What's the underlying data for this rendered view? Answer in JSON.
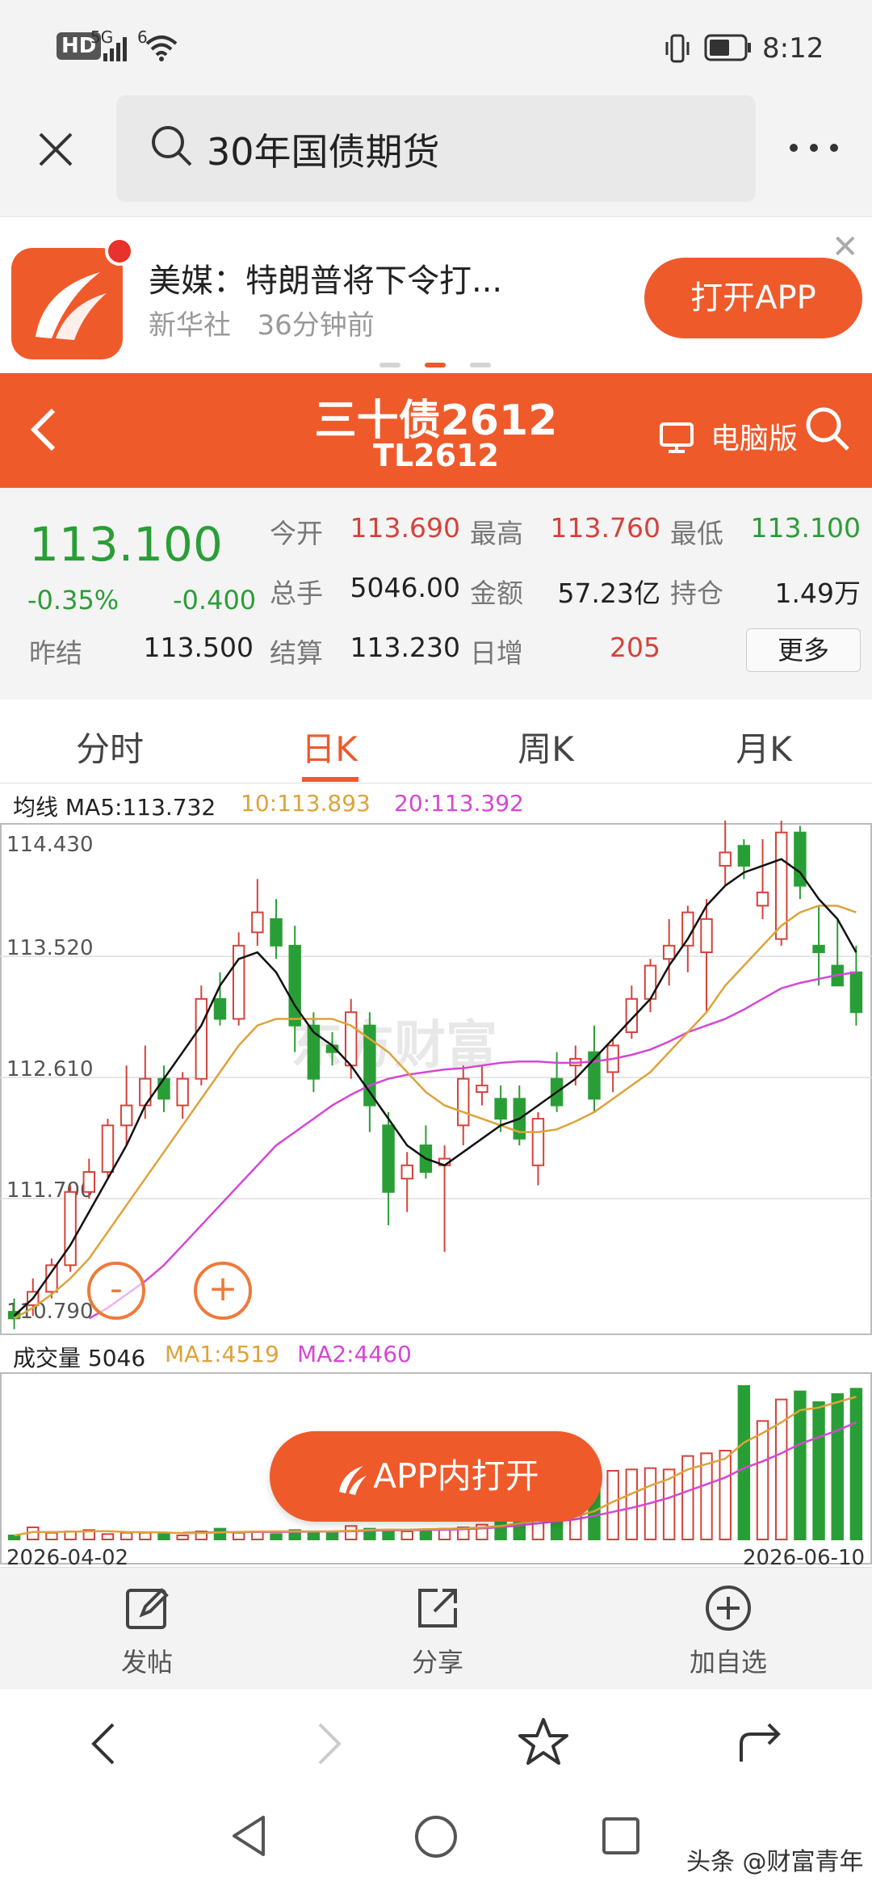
{
  "status_bar": {
    "hd": "HD",
    "signal_1": "5G",
    "signal_2": "6",
    "time": "8:12"
  },
  "search": {
    "query": "30年国债期货"
  },
  "ad": {
    "title": "美媒：特朗普将下令打...",
    "source": "新华社",
    "time_ago": "36分钟前",
    "open_app_label": "打开APP",
    "close_label": "✕"
  },
  "header": {
    "title": "三十债2612",
    "code": "TL2612",
    "pc_version_label": "电脑版"
  },
  "quote": {
    "last_price": "113.100",
    "change_pct": "-0.35%",
    "change_val": "-0.400",
    "rows": [
      [
        {
          "label": "今开",
          "value": "113.690",
          "color": "red"
        },
        {
          "label": "最高",
          "value": "113.760",
          "color": "red"
        },
        {
          "label": "最低",
          "value": "113.100",
          "color": "green"
        }
      ],
      [
        {
          "label": "总手",
          "value": "5046.00",
          "color": "dark"
        },
        {
          "label": "金额",
          "value": "57.23亿",
          "color": "dark"
        },
        {
          "label": "持仓",
          "value": "1.49万",
          "color": "dark"
        }
      ],
      [
        {
          "label": "结算",
          "value": "113.230",
          "color": "dark"
        },
        {
          "label": "日增",
          "value": "205",
          "color": "red"
        }
      ]
    ],
    "prev_settle_label": "昨结",
    "prev_settle_value": "113.500",
    "more_label": "更多"
  },
  "tabs": [
    {
      "label": "分时",
      "active": false
    },
    {
      "label": "日K",
      "active": true
    },
    {
      "label": "周K",
      "active": false
    },
    {
      "label": "月K",
      "active": false
    }
  ],
  "ma_legend": {
    "ma5": "均线 MA5:113.732",
    "ma10": "10:113.893",
    "ma20": "20:113.392"
  },
  "vol_legend": {
    "vol": "成交量 5046",
    "ma1": "MA1:4519",
    "ma2": "MA2:4460"
  },
  "colors": {
    "accent": "#ef5a2b",
    "up": "#d5423b",
    "down": "#2a9e36",
    "ma5": "#111111",
    "ma10": "#dda33a",
    "ma20": "#d646d6"
  },
  "chart_data": {
    "type": "candlestick",
    "y_ticks": [
      "114.430",
      "113.520",
      "112.610",
      "111.700",
      "110.790"
    ],
    "ylim": [
      110.79,
      114.43
    ],
    "x_start_label": "2026-04-02",
    "x_end_label": "2026-06-10",
    "watermark": "东方财富",
    "candles": [
      [
        110.85,
        110.95,
        110.72,
        110.8
      ],
      [
        110.9,
        111.1,
        110.82,
        111.0
      ],
      [
        111.0,
        111.25,
        110.95,
        111.2
      ],
      [
        111.2,
        111.8,
        111.15,
        111.75
      ],
      [
        111.75,
        112.0,
        111.7,
        111.9
      ],
      [
        111.9,
        112.3,
        111.85,
        112.25
      ],
      [
        112.25,
        112.7,
        112.1,
        112.4
      ],
      [
        112.4,
        112.85,
        112.3,
        112.6
      ],
      [
        112.6,
        112.7,
        112.35,
        112.45
      ],
      [
        112.4,
        112.65,
        112.3,
        112.6
      ],
      [
        112.6,
        113.3,
        112.55,
        113.2
      ],
      [
        113.2,
        113.4,
        113.0,
        113.05
      ],
      [
        113.05,
        113.7,
        113.0,
        113.6
      ],
      [
        113.7,
        114.1,
        113.6,
        113.85
      ],
      [
        113.8,
        113.95,
        113.5,
        113.6
      ],
      [
        113.6,
        113.75,
        112.8,
        113.0
      ],
      [
        113.0,
        113.1,
        112.5,
        112.6
      ],
      [
        112.85,
        112.95,
        112.7,
        112.8
      ],
      [
        112.7,
        113.2,
        112.6,
        113.1
      ],
      [
        113.0,
        113.1,
        112.2,
        112.4
      ],
      [
        112.25,
        112.35,
        111.5,
        111.75
      ],
      [
        111.85,
        112.05,
        111.6,
        111.95
      ],
      [
        112.1,
        112.25,
        111.85,
        111.9
      ],
      [
        111.95,
        112.1,
        111.3,
        112.0
      ],
      [
        112.25,
        112.7,
        112.1,
        112.6
      ],
      [
        112.5,
        112.7,
        112.4,
        112.55
      ],
      [
        112.45,
        112.55,
        112.2,
        112.3
      ],
      [
        112.45,
        112.55,
        112.1,
        112.15
      ],
      [
        111.95,
        112.35,
        111.8,
        112.3
      ],
      [
        112.6,
        112.8,
        112.35,
        112.4
      ],
      [
        112.7,
        112.85,
        112.55,
        112.75
      ],
      [
        112.8,
        113.0,
        112.35,
        112.45
      ],
      [
        112.65,
        112.9,
        112.5,
        112.85
      ],
      [
        112.95,
        113.3,
        112.9,
        113.2
      ],
      [
        113.2,
        113.5,
        113.1,
        113.45
      ],
      [
        113.5,
        113.8,
        113.3,
        113.6
      ],
      [
        113.6,
        113.9,
        113.4,
        113.85
      ],
      [
        113.55,
        113.95,
        113.1,
        113.8
      ],
      [
        114.2,
        114.6,
        114.05,
        114.3
      ],
      [
        114.35,
        114.4,
        114.1,
        114.2
      ],
      [
        113.9,
        114.4,
        113.8,
        114.0
      ],
      [
        113.65,
        114.55,
        113.6,
        114.45
      ],
      [
        114.45,
        114.5,
        113.95,
        114.05
      ],
      [
        113.6,
        113.9,
        113.3,
        113.55
      ],
      [
        113.45,
        113.8,
        113.3,
        113.3
      ],
      [
        113.4,
        113.6,
        113.0,
        113.1
      ]
    ],
    "ma5": [
      110.82,
      110.95,
      111.15,
      111.35,
      111.6,
      111.85,
      112.1,
      112.4,
      112.6,
      112.8,
      113.0,
      113.3,
      113.5,
      113.55,
      113.4,
      113.15,
      112.95,
      112.85,
      112.7,
      112.5,
      112.3,
      112.1,
      112.0,
      111.95,
      112.05,
      112.15,
      112.25,
      112.3,
      112.4,
      112.5,
      112.6,
      112.75,
      112.9,
      113.05,
      113.2,
      113.45,
      113.65,
      113.9,
      114.05,
      114.15,
      114.2,
      114.25,
      114.15,
      113.95,
      113.8,
      113.55
    ],
    "ma10": [
      110.8,
      110.88,
      110.98,
      111.1,
      111.25,
      111.45,
      111.65,
      111.85,
      112.05,
      112.25,
      112.45,
      112.65,
      112.85,
      113.0,
      113.05,
      113.05,
      113.05,
      113.05,
      113.0,
      112.9,
      112.8,
      112.65,
      112.5,
      112.4,
      112.35,
      112.3,
      112.25,
      112.2,
      112.2,
      112.22,
      112.28,
      112.35,
      112.45,
      112.55,
      112.65,
      112.8,
      112.95,
      113.1,
      113.3,
      113.45,
      113.6,
      113.75,
      113.85,
      113.9,
      113.9,
      113.85
    ],
    "ma20": [
      null,
      null,
      null,
      null,
      110.8,
      110.88,
      110.98,
      111.08,
      111.2,
      111.35,
      111.5,
      111.65,
      111.8,
      111.95,
      112.1,
      112.2,
      112.3,
      112.4,
      112.48,
      112.55,
      112.6,
      112.63,
      112.65,
      112.67,
      112.68,
      112.7,
      112.72,
      112.73,
      112.73,
      112.72,
      112.72,
      112.73,
      112.75,
      112.78,
      112.82,
      112.88,
      112.95,
      113.0,
      113.05,
      113.12,
      113.2,
      113.28,
      113.32,
      113.35,
      113.38,
      113.4
    ],
    "volumes": [
      300,
      900,
      500,
      600,
      700,
      400,
      500,
      500,
      400,
      300,
      600,
      800,
      500,
      600,
      400,
      700,
      600,
      500,
      1000,
      800,
      700,
      600,
      700,
      800,
      900,
      1100,
      1300,
      1800,
      1600,
      1400,
      2000,
      4000,
      5100,
      5200,
      5300,
      5200,
      6200,
      6400,
      6600,
      11400,
      8800,
      10400,
      11000,
      10200,
      10800,
      11200
    ],
    "vol_ma1": [
      300,
      550,
      560,
      575,
      600,
      620,
      560,
      540,
      520,
      470,
      480,
      520,
      560,
      580,
      600,
      600,
      600,
      600,
      650,
      700,
      740,
      720,
      760,
      780,
      820,
      880,
      1000,
      1200,
      1400,
      1560,
      1700,
      2100,
      2800,
      3400,
      4000,
      4500,
      5200,
      5600,
      6000,
      7200,
      7900,
      8700,
      9600,
      9800,
      10200,
      10600
    ],
    "vol_ma2": [
      null,
      null,
      null,
      null,
      null,
      null,
      null,
      null,
      null,
      500,
      520,
      540,
      550,
      560,
      560,
      570,
      580,
      590,
      620,
      650,
      680,
      690,
      700,
      720,
      760,
      820,
      920,
      1050,
      1200,
      1350,
      1500,
      1750,
      2050,
      2350,
      2700,
      3100,
      3600,
      4100,
      4600,
      5300,
      5800,
      6400,
      7100,
      7600,
      8100,
      8700
    ],
    "vol_ylim": [
      0,
      12000
    ]
  },
  "zoom": {
    "minus": "-",
    "plus": "+"
  },
  "app_open_pill": "APP内打开",
  "actions": [
    {
      "label": "发帖",
      "icon": "edit-icon"
    },
    {
      "label": "分享",
      "icon": "share-icon"
    },
    {
      "label": "加自选",
      "icon": "add-circle-icon"
    }
  ],
  "system": {
    "watermark": "头条 @财富青年"
  }
}
